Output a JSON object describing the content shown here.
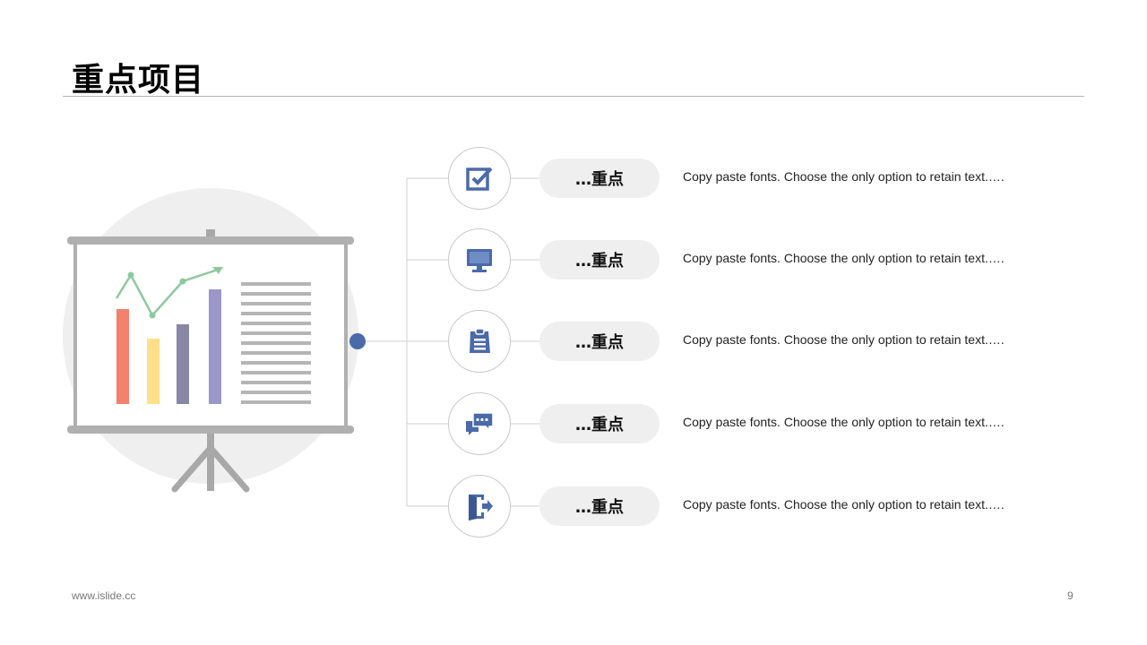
{
  "title": "重点项目",
  "items": [
    {
      "label": "…重点",
      "text": "Copy paste fonts. Choose the only option to retain text.….",
      "icon": "checkbox-icon"
    },
    {
      "label": "…重点",
      "text": "Copy paste fonts. Choose the only option to retain text.….",
      "icon": "monitor-icon"
    },
    {
      "label": "…重点",
      "text": "Copy paste fonts. Choose the only option to retain text.….",
      "icon": "clipboard-icon"
    },
    {
      "label": "…重点",
      "text": "Copy paste fonts. Choose the only option to retain text.….",
      "icon": "chat-icon"
    },
    {
      "label": "…重点",
      "text": "Copy paste fonts. Choose the only option to retain text.….",
      "icon": "exit-door-icon"
    }
  ],
  "footer": {
    "url": "www.islide.cc",
    "page": "9"
  },
  "colors": {
    "accent": "#4a6aaa",
    "bar_colors": [
      "#f4806e",
      "#ffe08a",
      "#8a87a6",
      "#9b97c8"
    ],
    "trend_line": "#8ec99e",
    "pill_bg": "#efefef"
  }
}
